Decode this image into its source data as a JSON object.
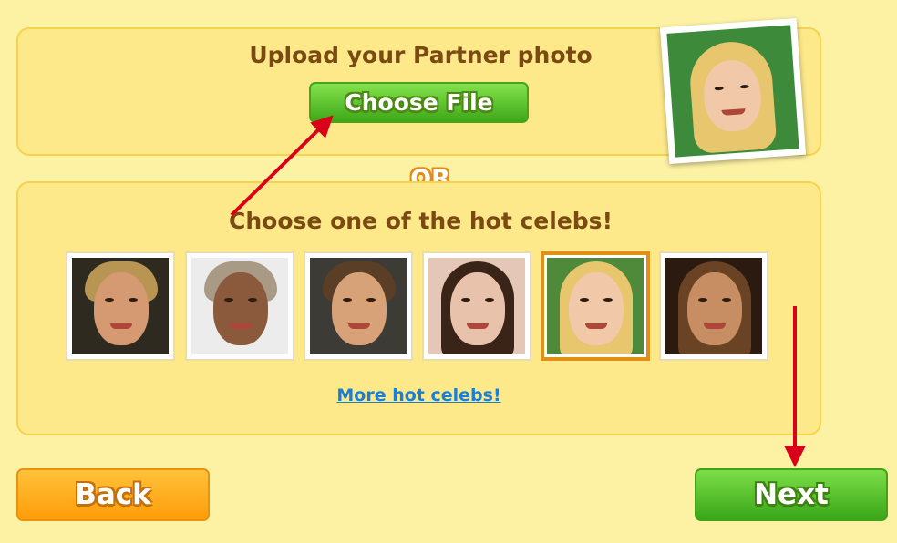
{
  "upload": {
    "title": "Upload your Partner photo",
    "choose_file_label": "Choose File"
  },
  "or_label": "OR",
  "celebs": {
    "title": "Choose one of the hot celebs!",
    "more_link": "More hot celebs!",
    "selected_index": 4,
    "thumbnails": [
      {
        "name": "celeb-photo-1",
        "bg": "#2f2a20",
        "skin": "#d69a72",
        "hair": "#b89552"
      },
      {
        "name": "celeb-photo-2",
        "bg": "#ececec",
        "skin": "#8b5a3c",
        "hair": "#a89a84"
      },
      {
        "name": "celeb-photo-3",
        "bg": "#3d3b35",
        "skin": "#d7a277",
        "hair": "#5a3e26"
      },
      {
        "name": "celeb-photo-4",
        "bg": "#e4c7b6",
        "skin": "#e9c2ac",
        "hair": "#3a2418"
      },
      {
        "name": "celeb-photo-5",
        "bg": "#4f8a3a",
        "skin": "#f1c9a8",
        "hair": "#e8c66d"
      },
      {
        "name": "celeb-photo-6",
        "bg": "#2a1a10",
        "skin": "#c68e62",
        "hair": "#6a4224"
      }
    ]
  },
  "buttons": {
    "back": "Back",
    "next": "Next"
  },
  "colors": {
    "arrow": "#d9001a",
    "accent_green": "#3ea81a",
    "accent_orange": "#ff9d0a"
  }
}
